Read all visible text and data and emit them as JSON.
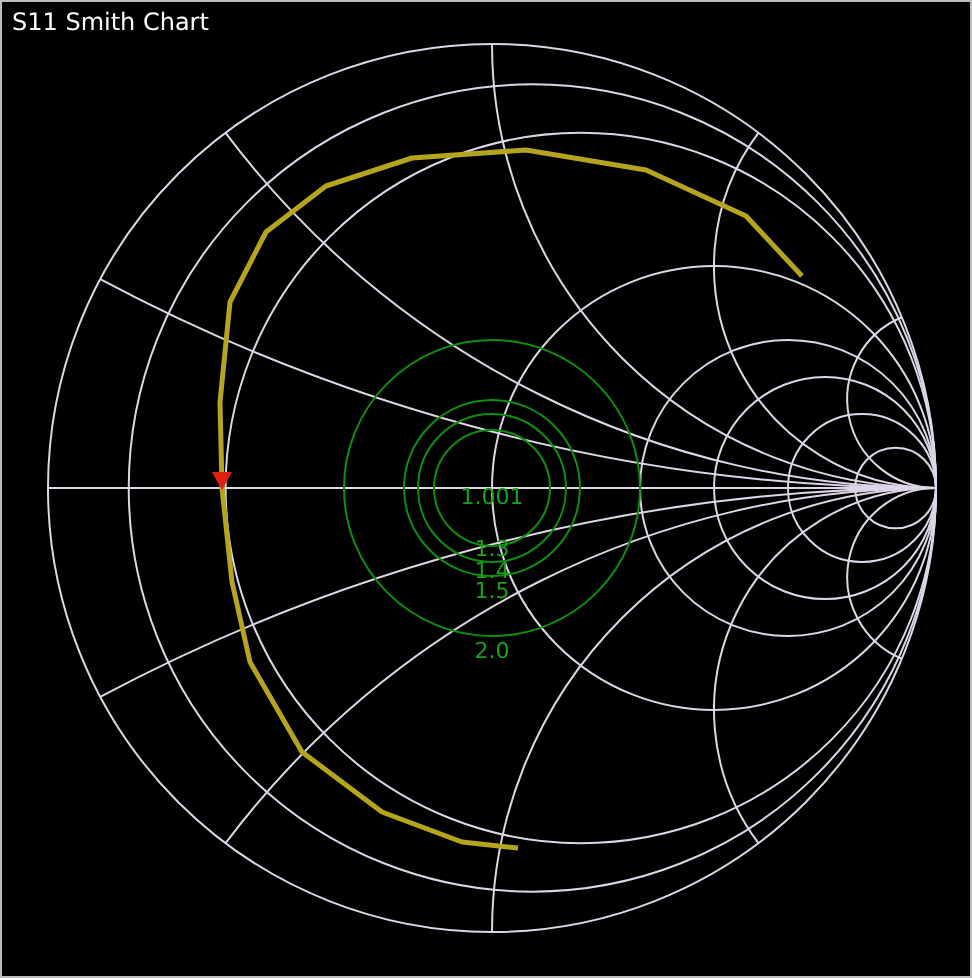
{
  "title": "S11 Smith Chart",
  "vswr_circles": [
    {
      "label": "1.001"
    },
    {
      "label": "1.3"
    },
    {
      "label": "1.4"
    },
    {
      "label": "1.5"
    },
    {
      "label": "2.0"
    }
  ]
}
